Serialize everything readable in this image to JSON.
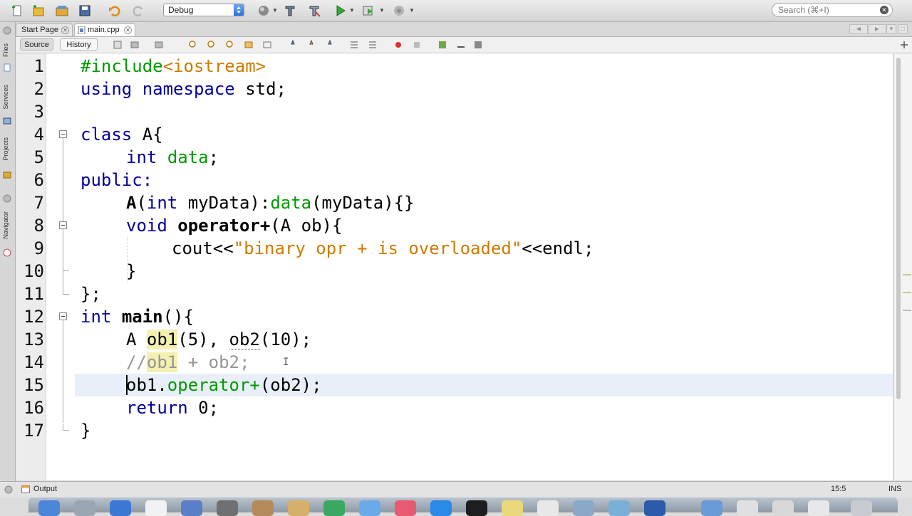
{
  "toolbar": {
    "config_value": "Debug",
    "search_placeholder": "Search (⌘+I)",
    "search_clear": "✕"
  },
  "tabs": [
    {
      "label": "Start Page",
      "close": "✕"
    },
    {
      "label": "main.cpp",
      "close": "✕"
    }
  ],
  "editor_toolbar": {
    "source_label": "Source",
    "history_label": "History"
  },
  "left_panels": [
    "Files",
    "Services",
    "Projects",
    "Navigator"
  ],
  "line_numbers": [
    "1",
    "2",
    "3",
    "4",
    "5",
    "6",
    "7",
    "8",
    "9",
    "10",
    "11",
    "12",
    "13",
    "14",
    "15",
    "16",
    "17"
  ],
  "code": {
    "l1_directive": "#include",
    "l1_header": "<iostream>",
    "l2_kw": "using namespace",
    "l2_rest": " std;",
    "l4_kw": "class",
    "l4_rest": " A{",
    "l5_kw": "int",
    "l5_field": "data",
    "l5_rest": ";",
    "l6_kw": "public:",
    "l7_ctor": "A",
    "l7_p1": "(",
    "l7_kw": "int",
    "l7_p2": " myData):",
    "l7_field": "data",
    "l7_p3": "(myData){}",
    "l8_kw": "void",
    "l8_op": "operator+",
    "l8_rest": "(A ob){",
    "l9_cout": "cout<<",
    "l9_str": "\"binary opr + is overloaded\"",
    "l9_rest": "<<endl;",
    "l10": "}",
    "l11": "};",
    "l12_kw": "int",
    "l12_fn": "main",
    "l12_rest": "(){",
    "l13_a": "A ",
    "l13_ob1": "ob1",
    "l13_mid": "(5), ",
    "l13_ob2": "ob2",
    "l13_rest": "(10);",
    "l14_slash": "//",
    "l14_ob1": "ob1",
    "l14_rest": " + ob2;",
    "l15_ob1": "ob1.",
    "l15_op": "operator+",
    "l15_rest": "(ob2);",
    "l16_kw": "return",
    "l16_rest": " 0;",
    "l17": "}"
  },
  "status": {
    "output_label": "Output",
    "position": "15:5",
    "mode": "INS"
  },
  "colors": {
    "keyword": "#000099",
    "string": "#ce7b00",
    "field": "#009900",
    "comment": "#969696",
    "occurrence_highlight": "#f3f0b2",
    "current_line": "#e9eff8"
  }
}
